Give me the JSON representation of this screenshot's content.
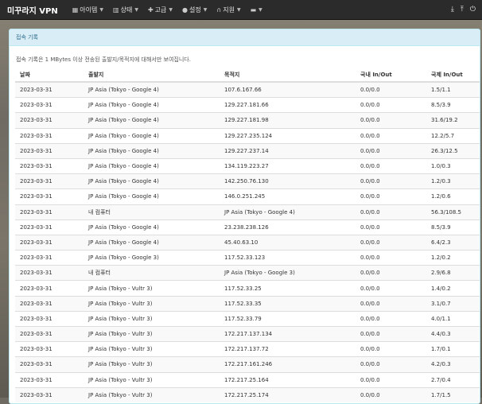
{
  "navbar": {
    "brand": "미꾸라지 VPN",
    "menu": [
      {
        "label": "아이템",
        "icon": "grid-icon",
        "glyph": "▦"
      },
      {
        "label": "상태",
        "icon": "bar-chart-icon",
        "glyph": "▥"
      },
      {
        "label": "고급",
        "icon": "wrench-icon",
        "glyph": "✚"
      },
      {
        "label": "설정",
        "icon": "user-icon",
        "glyph": "●"
      },
      {
        "label": "지원",
        "icon": "headset-icon",
        "glyph": "∩"
      },
      {
        "label": "",
        "icon": "more-icon",
        "glyph": "▬"
      }
    ],
    "right_icons": [
      {
        "icon": "download-icon",
        "glyph": "⤓"
      },
      {
        "icon": "upload-icon",
        "glyph": "⤒"
      },
      {
        "icon": "power-icon",
        "glyph": "⏻"
      }
    ]
  },
  "panel": {
    "title": "접속 기록",
    "note": "접속 기록은 1 MBytes 이상 전송된 출발지/목적지에 대해서만 보여집니다."
  },
  "table": {
    "headers": [
      "날짜",
      "출발지",
      "목적지",
      "국내 In/Out",
      "국제 In/Out"
    ],
    "rows": [
      [
        "2023-03-31",
        "JP Asia (Tokyo - Google 4)",
        "107.6.167.66",
        "0.0/0.0",
        "1.5/1.1"
      ],
      [
        "2023-03-31",
        "JP Asia (Tokyo - Google 4)",
        "129.227.181.66",
        "0.0/0.0",
        "8.5/3.9"
      ],
      [
        "2023-03-31",
        "JP Asia (Tokyo - Google 4)",
        "129.227.181.98",
        "0.0/0.0",
        "31.6/19.2"
      ],
      [
        "2023-03-31",
        "JP Asia (Tokyo - Google 4)",
        "129.227.235.124",
        "0.0/0.0",
        "12.2/5.7"
      ],
      [
        "2023-03-31",
        "JP Asia (Tokyo - Google 4)",
        "129.227.237.14",
        "0.0/0.0",
        "26.3/12.5"
      ],
      [
        "2023-03-31",
        "JP Asia (Tokyo - Google 4)",
        "134.119.223.27",
        "0.0/0.0",
        "1.0/0.3"
      ],
      [
        "2023-03-31",
        "JP Asia (Tokyo - Google 4)",
        "142.250.76.130",
        "0.0/0.0",
        "1.2/0.3"
      ],
      [
        "2023-03-31",
        "JP Asia (Tokyo - Google 4)",
        "146.0.251.245",
        "0.0/0.0",
        "1.2/0.6"
      ],
      [
        "2023-03-31",
        "내 컴퓨터",
        "JP Asia (Tokyo - Google 4)",
        "0.0/0.0",
        "56.3/108.5"
      ],
      [
        "2023-03-31",
        "JP Asia (Tokyo - Google 4)",
        "23.238.238.126",
        "0.0/0.0",
        "8.5/3.9"
      ],
      [
        "2023-03-31",
        "JP Asia (Tokyo - Google 4)",
        "45.40.63.10",
        "0.0/0.0",
        "6.4/2.3"
      ],
      [
        "2023-03-31",
        "JP Asia (Tokyo - Google 3)",
        "117.52.33.123",
        "0.0/0.0",
        "1.2/0.2"
      ],
      [
        "2023-03-31",
        "내 컴퓨터",
        "JP Asia (Tokyo - Google 3)",
        "0.0/0.0",
        "2.9/6.8"
      ],
      [
        "2023-03-31",
        "JP Asia (Tokyo - Vultr 3)",
        "117.52.33.25",
        "0.0/0.0",
        "1.4/0.2"
      ],
      [
        "2023-03-31",
        "JP Asia (Tokyo - Vultr 3)",
        "117.52.33.35",
        "0.0/0.0",
        "3.1/0.7"
      ],
      [
        "2023-03-31",
        "JP Asia (Tokyo - Vultr 3)",
        "117.52.33.79",
        "0.0/0.0",
        "4.0/1.1"
      ],
      [
        "2023-03-31",
        "JP Asia (Tokyo - Vultr 3)",
        "172.217.137.134",
        "0.0/0.0",
        "4.4/0.3"
      ],
      [
        "2023-03-31",
        "JP Asia (Tokyo - Vultr 3)",
        "172.217.137.72",
        "0.0/0.0",
        "1.7/0.1"
      ],
      [
        "2023-03-31",
        "JP Asia (Tokyo - Vultr 3)",
        "172.217.161.246",
        "0.0/0.0",
        "4.2/0.3"
      ],
      [
        "2023-03-31",
        "JP Asia (Tokyo - Vultr 3)",
        "172.217.25.164",
        "0.0/0.0",
        "2.7/0.4"
      ],
      [
        "2023-03-31",
        "JP Asia (Tokyo - Vultr 3)",
        "172.217.25.174",
        "0.0/0.0",
        "1.7/1.5"
      ]
    ]
  }
}
